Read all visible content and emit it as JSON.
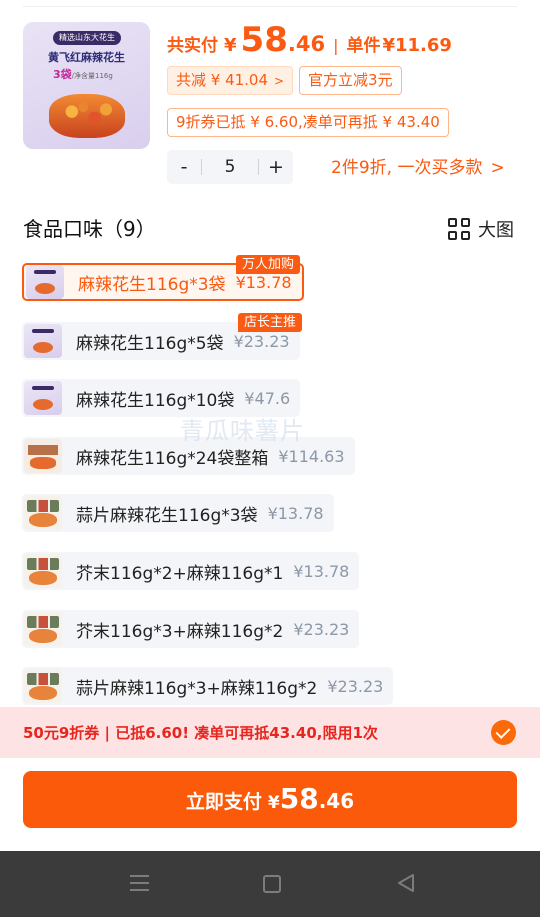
{
  "product": {
    "image": {
      "tag": "精选山东大花生",
      "name": "黄飞红麻辣花生",
      "qty": "3袋",
      "net": "/净含量116g"
    },
    "pay_label": "共实付",
    "pay_currency": "¥",
    "pay_int": "58",
    "pay_dec": ".46",
    "separator": "|",
    "unit_label": "单件",
    "unit_price": "¥11.69",
    "discount_total": "共减 ¥ 41.04",
    "discount_chevron": ">",
    "official_discount": "官方立减3元",
    "coupon_info": "9折券已抵 ¥ 6.60,凑单可再抵 ¥ 43.40",
    "quantity": "5",
    "minus": "-",
    "plus": "+",
    "multi_buy": "2件9折, 一次买多款",
    "multi_chevron": ">"
  },
  "section": {
    "title": "食品口味（9）",
    "view_label": "大图"
  },
  "options": [
    {
      "label": "麻辣花生116g*3袋",
      "price": "¥13.78",
      "tag": "万人加购",
      "selected": true
    },
    {
      "label": "麻辣花生116g*5袋",
      "price": "¥23.23",
      "tag": "店长主推"
    },
    {
      "label": "麻辣花生116g*10袋",
      "price": "¥47.6"
    },
    {
      "label": "麻辣花生116g*24袋整箱",
      "price": "¥114.63"
    },
    {
      "label": "蒜片麻辣花生116g*3袋",
      "price": "¥13.78"
    },
    {
      "label": "芥末116g*2+麻辣116g*1",
      "price": "¥13.78"
    },
    {
      "label": "芥末116g*3+麻辣116g*2",
      "price": "¥23.23"
    },
    {
      "label": "蒜片麻辣116g*3+麻辣116g*2",
      "price": "¥23.23"
    }
  ],
  "watermark": "青瓜味薯片",
  "coupon_bar": {
    "text": "50元9折券 | 已抵6.60! 凑单可再抵43.40,限用1次"
  },
  "pay_button": {
    "label": "立即支付",
    "currency": "¥",
    "int": "58",
    "dec": ".46"
  },
  "icons": {
    "view": "grid-icon",
    "check": "check-circle-icon",
    "nav": [
      "menu-icon",
      "home-icon",
      "back-icon"
    ]
  },
  "colors": {
    "accent": "#fa5a12",
    "price_gray": "#8c98a8",
    "coupon_bg": "#fde3e3",
    "coupon_text": "#e8261f"
  }
}
